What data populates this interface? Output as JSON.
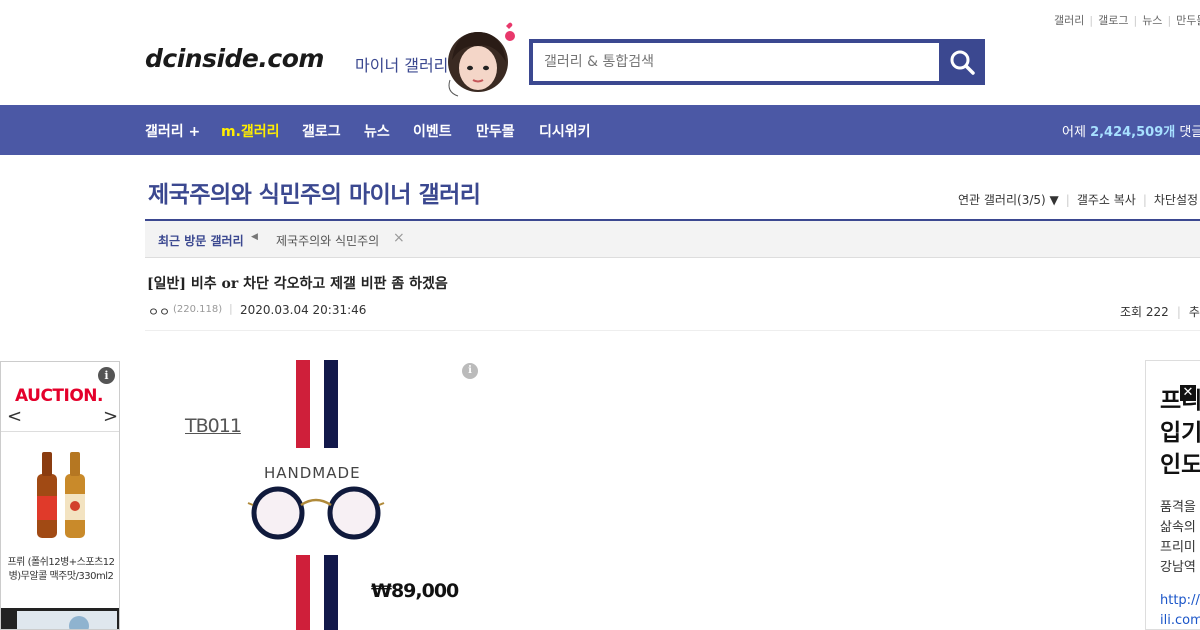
{
  "top_links": [
    "갤러리",
    "갤로그",
    "뉴스",
    "만두몰"
  ],
  "header": {
    "logo": "dcinside.com",
    "logo_sub": "마이너 갤러리",
    "search_placeholder": "갤러리 & 통합검색",
    "search_icon": "search-icon",
    "accent": "#3b4890"
  },
  "nav": {
    "items": [
      "갤러리 +",
      "m.갤러리",
      "갤로그",
      "뉴스",
      "이벤트",
      "만두몰",
      "디시위키"
    ],
    "active_index": 1,
    "stats_prefix": "어제",
    "stats_value": "2,424,509개",
    "stats_suffix": "댓글",
    "bg": "#4b58a5"
  },
  "gallery": {
    "title": "제국주의와 식민주의 마이너 갤러리",
    "links": [
      "연관 갤러리(3/5)",
      "갤주소 복사",
      "차단설정"
    ],
    "recent_label": "최근 방문 갤러리",
    "recent_items": [
      "제국주의와 식민주의"
    ]
  },
  "post": {
    "title": "[일반] 비추 or 차단 각오하고 제갤 비판 좀 하겠음",
    "author": "ㅇㅇ",
    "ip": "(220.118)",
    "date": "2020.03.04 20:31:46",
    "views_label": "조회 222",
    "recommend_label": "추천"
  },
  "left_ad": {
    "brand": "AUCTION.",
    "info": "i",
    "product_text": "프뤼 (폴쉬12병+스포츠12병)무알콜 맥주맛/330ml2"
  },
  "center_ad": {
    "model": "TB011",
    "tagline": "HANDMADE",
    "price": "₩89,000",
    "info": "i"
  },
  "right_ad": {
    "headline": [
      "프리",
      "입기",
      "인도"
    ],
    "body": [
      "품격을",
      "삶속의",
      "프리미",
      "강남역"
    ],
    "link": [
      "http://w",
      "ili.com"
    ]
  }
}
